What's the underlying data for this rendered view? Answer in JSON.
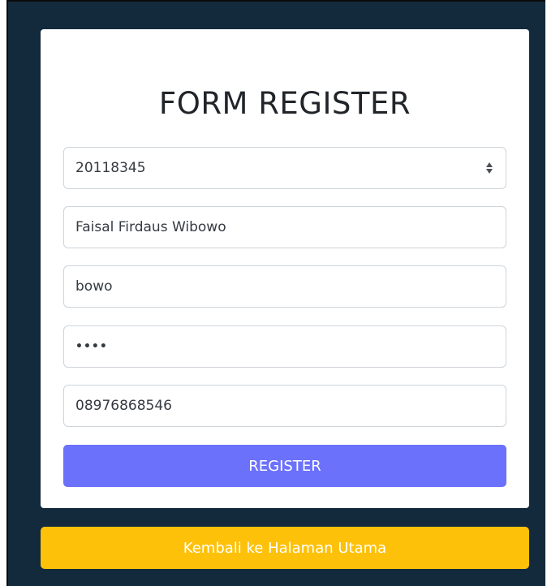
{
  "form": {
    "title": "FORM REGISTER",
    "fields": [
      {
        "name": "nim",
        "value": "20118345",
        "type": "number"
      },
      {
        "name": "full_name",
        "value": "Faisal Firdaus Wibowo",
        "type": "text"
      },
      {
        "name": "username",
        "value": "bowo",
        "type": "text"
      },
      {
        "name": "password",
        "value": "••••",
        "type": "password"
      },
      {
        "name": "phone",
        "value": "08976868546",
        "type": "text"
      }
    ],
    "register_label": "REGISTER"
  },
  "back_button_label": "Kembali ke Halaman Utama",
  "colors": {
    "page_background": "#132a3d",
    "register_button": "#6b71fb",
    "back_button": "#fdc10a"
  },
  "icons": {
    "spinner": "number-spinner-icon"
  }
}
